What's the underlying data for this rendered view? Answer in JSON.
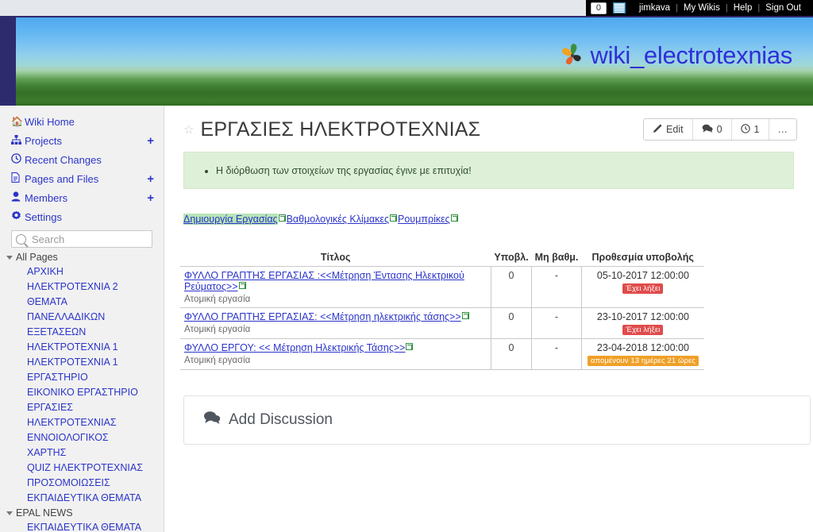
{
  "topbar": {
    "notification_count": "0",
    "wiki_icon": "wiki-book-icon",
    "username": "jimkava",
    "my_wikis": "My Wikis",
    "help": "Help",
    "sign_out": "Sign Out",
    "separator": "|"
  },
  "banner": {
    "logo_text": "wiki_electrotexnias",
    "logo_icon": "pinwheel-icon",
    "logo_color": "#2f2fd8"
  },
  "sidebar": {
    "nav": [
      {
        "icon": "home-icon",
        "label": "Wiki Home",
        "plus": ""
      },
      {
        "icon": "sitemap-icon",
        "label": "Projects",
        "plus": "+"
      },
      {
        "icon": "clock-icon",
        "label": "Recent Changes",
        "plus": ""
      },
      {
        "icon": "file-icon",
        "label": "Pages and Files",
        "plus": "+"
      },
      {
        "icon": "user-icon",
        "label": "Members",
        "plus": "+"
      },
      {
        "icon": "gear-icon",
        "label": "Settings",
        "plus": ""
      }
    ],
    "search_placeholder": "Search",
    "search_value": "",
    "groups": [
      {
        "label": "All Pages",
        "pages": [
          "ΑΡΧΙΚΗ",
          "ΗΛΕΚΤΡΟΤΕΧΝΙΑ 2",
          "ΘΕΜΑΤΑ",
          "ΠΑΝΕΛΛΑΔΙΚΩΝ",
          "ΕΞΕΤΑΣΕΩΝ",
          "ΗΛΕΚΤΡΟΤΕΧΝΙΑ 1",
          "ΗΛΕΚΤΡΟΤΕΧΝΙΑ 1",
          "ΕΡΓΑΣΤΗΡΙΟ",
          "ΕΙΚΟΝΙΚΟ ΕΡΓΑΣΤΗΡΙΟ",
          "ΕΡΓΑΣΙΕΣ",
          "ΗΛΕΚΤΡΟΤΕΧΝΙΑΣ",
          "ΕΝΝΟΙΟΛΟΓΙΚΟΣ",
          "ΧΑΡΤΗΣ",
          "QUIZ ΗΛΕΚΤΡΟΤΕΧΝΙΑΣ",
          "ΠΡΟΣΟΜΟΙΩΣΕΙΣ",
          "ΕΚΠΑΙΔΕΥΤΙΚΑ ΘΕΜΑΤΑ"
        ]
      },
      {
        "label": "EPAL NEWS",
        "pages": [
          "ΕΚΠΑΙΔΕΥΤΙΚΑ ΘΕΜΑΤΑ"
        ]
      }
    ]
  },
  "main": {
    "star_icon": "star-outline-icon",
    "page_title": "ΕΡΓΑΣΙΕΣ ΗΛΕΚΤΡΟΤΕΧΝΙΑΣ",
    "toolbar": [
      {
        "icon": "pencil-icon",
        "label": "Edit"
      },
      {
        "icon": "comment-icon",
        "label": "0"
      },
      {
        "icon": "clock-icon",
        "label": "1"
      },
      {
        "icon": "ellipsis-icon",
        "label": "…"
      }
    ],
    "notice": {
      "text": "Η διόρθωση των στοιχείων της εργασίας έγινε με επιτυχία!",
      "background": "#dff0d8"
    },
    "links": [
      {
        "label": "Δημιουργία Εργασίας",
        "highlighted": true
      },
      {
        "label": "Βαθμολογικές Κλίμακες",
        "highlighted": false
      },
      {
        "label": "Ρουμπρίκες",
        "highlighted": false
      }
    ],
    "table": {
      "headers": [
        "Τίτλος",
        "Υποβλ.",
        "Μη βαθμ.",
        "Προθεσμία υποβολής"
      ],
      "rows": [
        {
          "title": "ΦΥΛΛΟ ΓΡΑΠΤΗΣ ΕΡΓΑΣΙΑΣ :<<Μέτρηση Έντασης Ηλεκτρικού Ρεύματος>>",
          "subtitle": "Ατομική εργασία",
          "submitted": "0",
          "ungraded": "-",
          "deadline": "05-10-2017 12:00:00",
          "badge": "Έχει λήξει",
          "badge_type": "expired"
        },
        {
          "title": "ΦΥΛΛΟ ΓΡΑΠΤΗΣ ΕΡΓΑΣΙΑΣ: <<Μέτρηση ηλεκτρικής τάσης>>",
          "subtitle": "Ατομική εργασία",
          "submitted": "0",
          "ungraded": "-",
          "deadline": "23-10-2017 12:00:00",
          "badge": "Έχει λήξει",
          "badge_type": "expired"
        },
        {
          "title": "ΦΥΛΛΟ ΕΡΓΟΥ: << Μέτρηση Ηλεκτρικής Τάσης>>",
          "subtitle": "Ατομική εργασία",
          "submitted": "0",
          "ungraded": "-",
          "deadline": "23-04-2018 12:00:00",
          "badge": "απομένουν 13 ημέρες 21 ώρες",
          "badge_type": "remain"
        }
      ]
    },
    "discussion": {
      "icon": "comment-icon",
      "label": "Add Discussion"
    }
  }
}
